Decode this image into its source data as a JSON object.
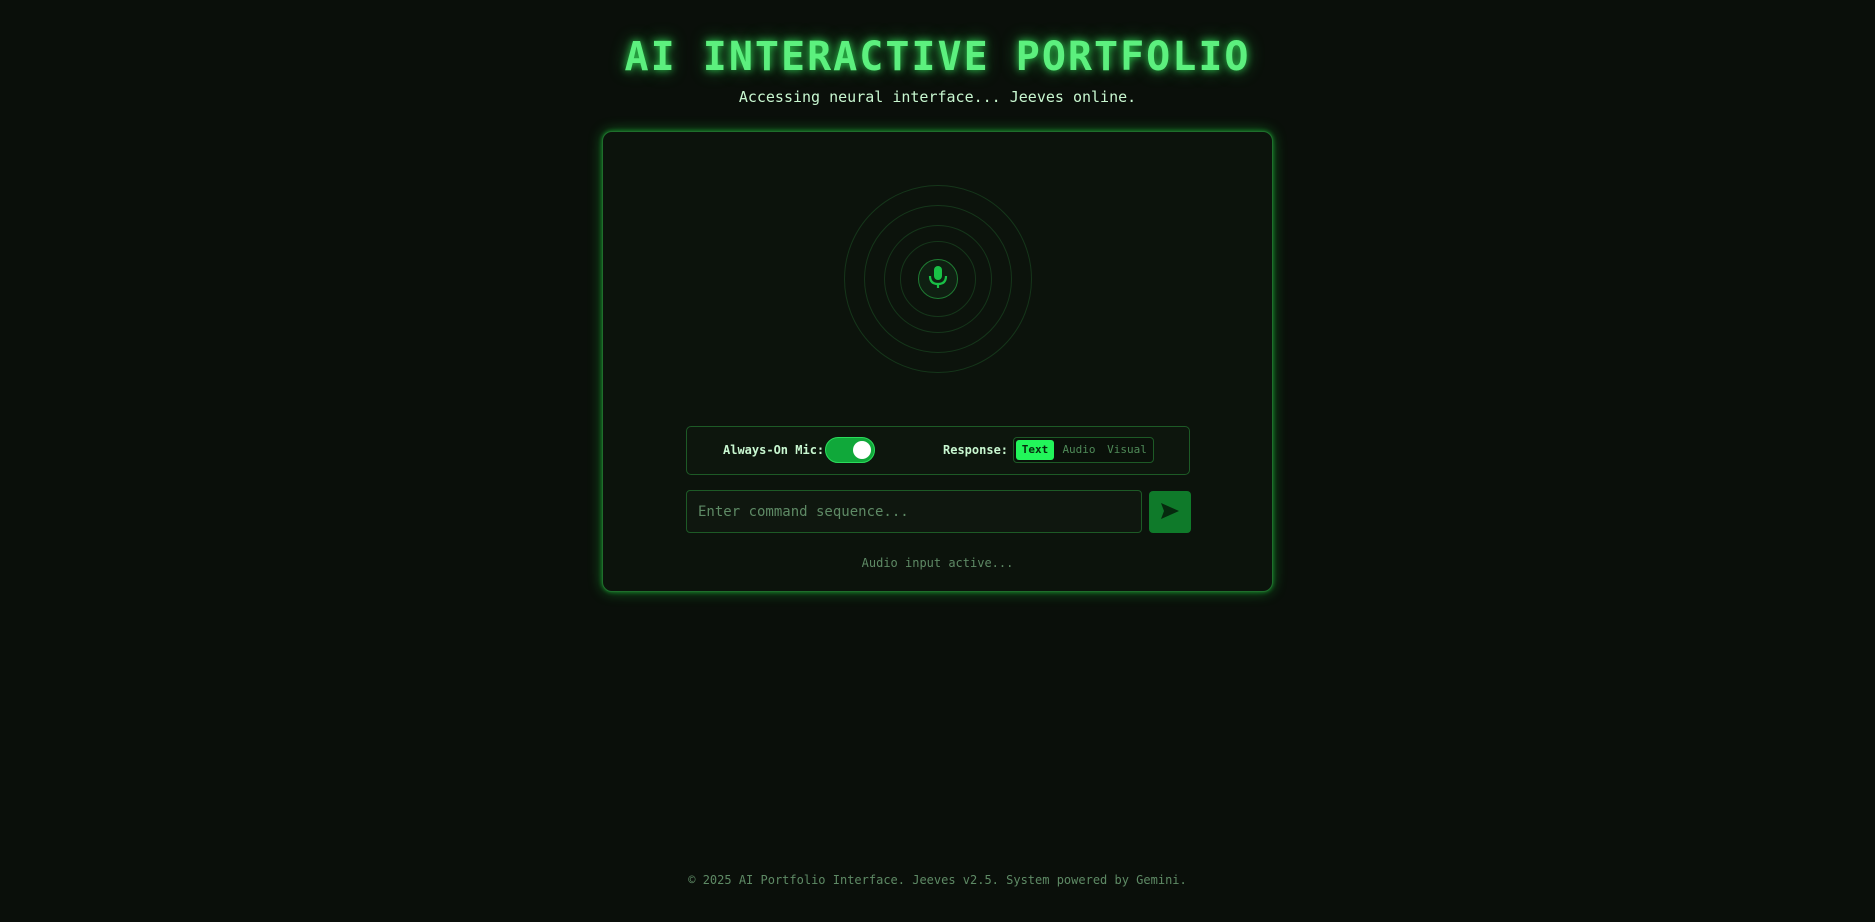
{
  "header": {
    "title": "AI INTERACTIVE PORTFOLIO",
    "subtitle": "Accessing neural interface... Jeeves online."
  },
  "voice_panel": {
    "mic_icon": "microphone-icon"
  },
  "controls": {
    "always_on_mic_label": "Always-On Mic:",
    "always_on_mic_enabled": true,
    "response_label": "Response:",
    "response_modes": [
      "Text",
      "Audio",
      "Visual"
    ],
    "response_selected": "Text"
  },
  "command": {
    "value": "",
    "placeholder": "Enter command sequence...",
    "send_icon": "send-arrow-icon"
  },
  "status": {
    "text": "Audio input active..."
  },
  "footer": {
    "text": "© 2025 AI Portfolio Interface. Jeeves v2.5. System powered by Gemini."
  },
  "colors": {
    "background": "#0a0f0a",
    "accent": "#22f55a",
    "title_glow": "#5cf07e",
    "panel_border": "#1f6e2c",
    "send_button": "#0f7a2a"
  }
}
